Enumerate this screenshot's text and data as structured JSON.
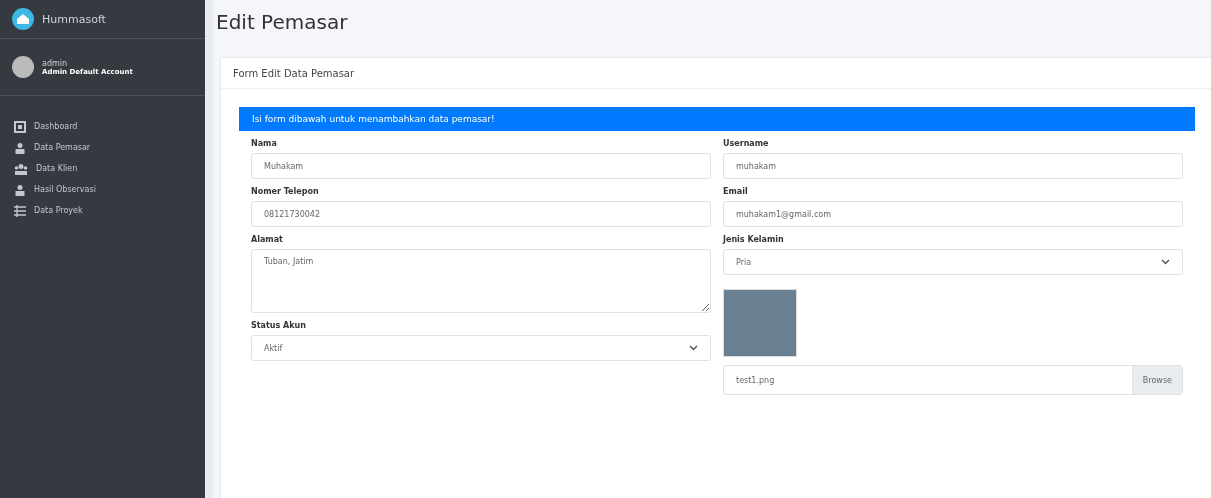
{
  "brand": {
    "name": "Hummasoft"
  },
  "user": {
    "name": "admin",
    "role": "Admin Default Account"
  },
  "nav": [
    {
      "label": "Dashboard"
    },
    {
      "label": "Data Pemasar"
    },
    {
      "label": "Data Klien"
    },
    {
      "label": "Hasil Observasi"
    },
    {
      "label": "Data Proyek"
    }
  ],
  "page_title": "Edit Pemasar",
  "card_title": "Form Edit Data Pemasar",
  "alert": "Isi form dibawah untuk menambahkan data pemasar!",
  "left_fields": [
    {
      "kind": "input",
      "label": "Nama",
      "value": "Muhakam"
    },
    {
      "kind": "input",
      "label": "Nomer Telepon",
      "value": "08121730042"
    },
    {
      "kind": "textarea",
      "label": "Alamat",
      "value": "Tuban, Jatim"
    },
    {
      "kind": "select",
      "label": "Status Akun",
      "value": "Aktif"
    }
  ],
  "right_fields": [
    {
      "kind": "input",
      "label": "Username",
      "value": "muhakam"
    },
    {
      "kind": "input",
      "label": "Email",
      "value": "muhakam1@gmail.com"
    },
    {
      "kind": "select",
      "label": "Jenis Kelamin",
      "value": "Pria"
    },
    {
      "kind": "photo"
    },
    {
      "kind": "file",
      "value": "test1.png",
      "button": "Browse"
    }
  ]
}
